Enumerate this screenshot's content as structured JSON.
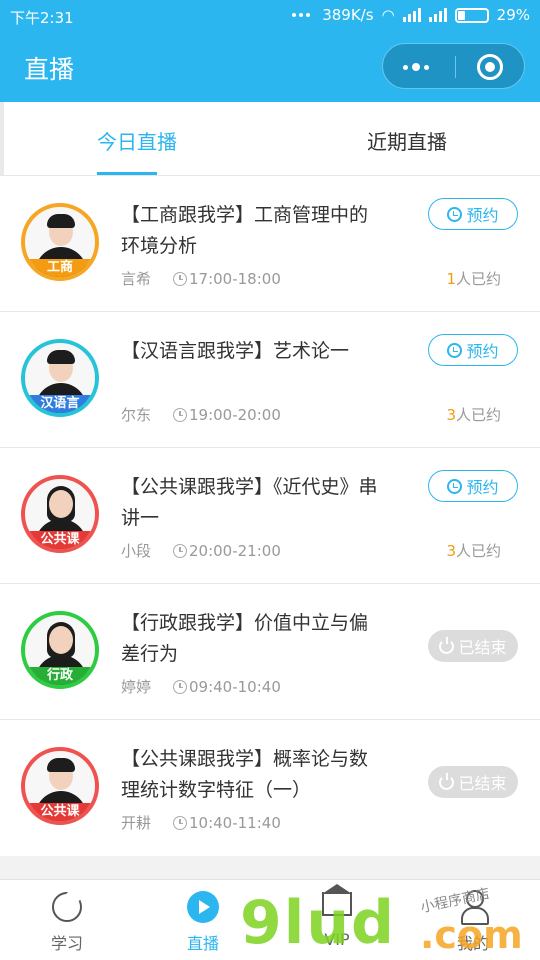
{
  "status_bar": {
    "time": "下午2:31",
    "speed": "389K/s",
    "battery": "29%"
  },
  "header": {
    "title": "直播"
  },
  "tabs": [
    {
      "label": "今日直播",
      "active": true
    },
    {
      "label": "近期直播",
      "active": false
    }
  ],
  "items": [
    {
      "title": "【工商跟我学】工商管理中的环境分析",
      "teacher": "言希",
      "time": "17:00-18:00",
      "action": "预约",
      "count": "1",
      "count_suffix": "人已约",
      "badge": "工商",
      "ring_color": "#f6a623",
      "badge_color": "#f39c12"
    },
    {
      "title": "【汉语言跟我学】艺术论一",
      "teacher": "尔东",
      "time": "19:00-20:00",
      "action": "预约",
      "count": "3",
      "count_suffix": "人已约",
      "badge": "汉语言",
      "ring_color": "#27c3d9",
      "badge_color": "#2f7de1"
    },
    {
      "title": "【公共课跟我学】《近代史》串讲一",
      "teacher": "小段",
      "time": "20:00-21:00",
      "action": "预约",
      "count": "3",
      "count_suffix": "人已约",
      "badge": "公共课",
      "ring_color": "#ef5350",
      "badge_color": "#e53935"
    },
    {
      "title": "【行政跟我学】价值中立与偏差行为",
      "teacher": "婷婷",
      "time": "09:40-10:40",
      "action": "已结束",
      "badge": "行政",
      "ring_color": "#2ecc40",
      "badge_color": "#27ae36"
    },
    {
      "title": "【公共课跟我学】概率论与数理统计数字特征（一）",
      "teacher": "开耕",
      "time": "10:40-11:40",
      "action": "已结束",
      "badge": "公共课",
      "ring_color": "#ef5350",
      "badge_color": "#e53935"
    }
  ],
  "nav": [
    {
      "label": "学习",
      "icon": "pacman-icon"
    },
    {
      "label": "直播",
      "icon": "play-icon",
      "active": true
    },
    {
      "label": "VIP",
      "icon": "crown-icon"
    },
    {
      "label": "我的",
      "icon": "person-icon"
    }
  ],
  "watermark": {
    "text": "9lud",
    "suffix": ".com",
    "cn": "小程序商店"
  },
  "colors": {
    "primary": "#2bb6ef",
    "accent_orange": "#f39c12",
    "ended_gray": "#dcdcdc"
  }
}
